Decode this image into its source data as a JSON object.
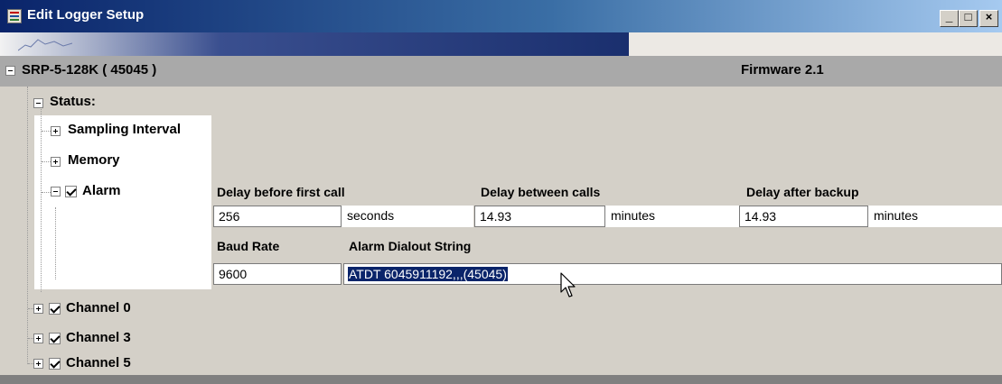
{
  "window": {
    "title": "Edit Logger Setup"
  },
  "device": {
    "name": "SRP-5-128K ( 45045 )",
    "firmware": "Firmware 2.1"
  },
  "tree": {
    "status": "Status:",
    "sampling_interval": "Sampling Interval",
    "memory": "Memory",
    "alarm": "Alarm",
    "channels": [
      "Channel 0",
      "Channel 3",
      "Channel 5"
    ]
  },
  "alarm_settings": {
    "delay_first_call": {
      "label": "Delay before first call",
      "value": "256",
      "unit": "seconds"
    },
    "delay_between_calls": {
      "label": "Delay between calls",
      "value": "14.93",
      "unit": "minutes"
    },
    "delay_after_backup": {
      "label": "Delay after backup",
      "value": "14.93",
      "unit": "minutes"
    },
    "baud_rate": {
      "label": "Baud Rate",
      "value": "9600"
    },
    "dialout": {
      "label": "Alarm Dialout String",
      "value": "ATDT 6045911192,,,(45045)"
    }
  },
  "icons": [
    "app-icon",
    "minimize-icon",
    "maximize-icon",
    "close-icon",
    "mouse-cursor-icon"
  ],
  "colors": {
    "titlebar": "#0a246a",
    "header_row": "#a9a9a9",
    "selection": "#0a246a"
  }
}
